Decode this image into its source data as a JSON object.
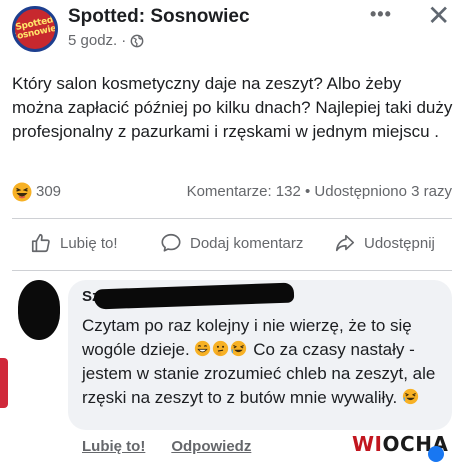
{
  "header": {
    "page_name": "Spotted: Sosnowiec",
    "time": "5 godz.",
    "separator": "·",
    "avatar_text": "Spotted Sosnowiec",
    "more_label": "•••",
    "close_label": "✕"
  },
  "post": {
    "text": "Który salon  kosmetyczny daje na zeszyt? Albo żeby można zapłacić później po kilku dnach? Najlepiej taki duży profesjonalny z pazurkami i rzęskami w jednym miejscu ."
  },
  "stats": {
    "reaction_count": "309",
    "comments_shares": "Komentarze: 132 • Udostępniono 3 razy"
  },
  "actions": {
    "like": "Lubię to!",
    "comment": "Dodaj komentarz",
    "share": "Udostępnij"
  },
  "comment": {
    "author_visible": "Sz                              ik",
    "text_part1": "Czytam po raz kolejny i nie wierzę, że to się wogóle dzieje.",
    "text_part2": "Co za czasy nastały - jestem w stanie zrozumieć chleb na zeszyt, ale rzęski na zeszyt to z butów mnie wywaliły.",
    "like_label": "Lubię to!",
    "reply_label": "Odpowiedz"
  },
  "watermark": {
    "text_a": "WI",
    "text_b": "OCHA"
  },
  "icons": {
    "haha": "haha-emoji-icon",
    "globe": "globe-icon",
    "like": "thumbs-up-icon",
    "comment": "speech-bubble-icon",
    "share": "share-arrow-icon"
  },
  "colors": {
    "text_primary": "#1c1e21",
    "text_secondary": "#65676b",
    "bubble_bg": "#f0f2f5",
    "watermark_red": "#c2161f"
  }
}
